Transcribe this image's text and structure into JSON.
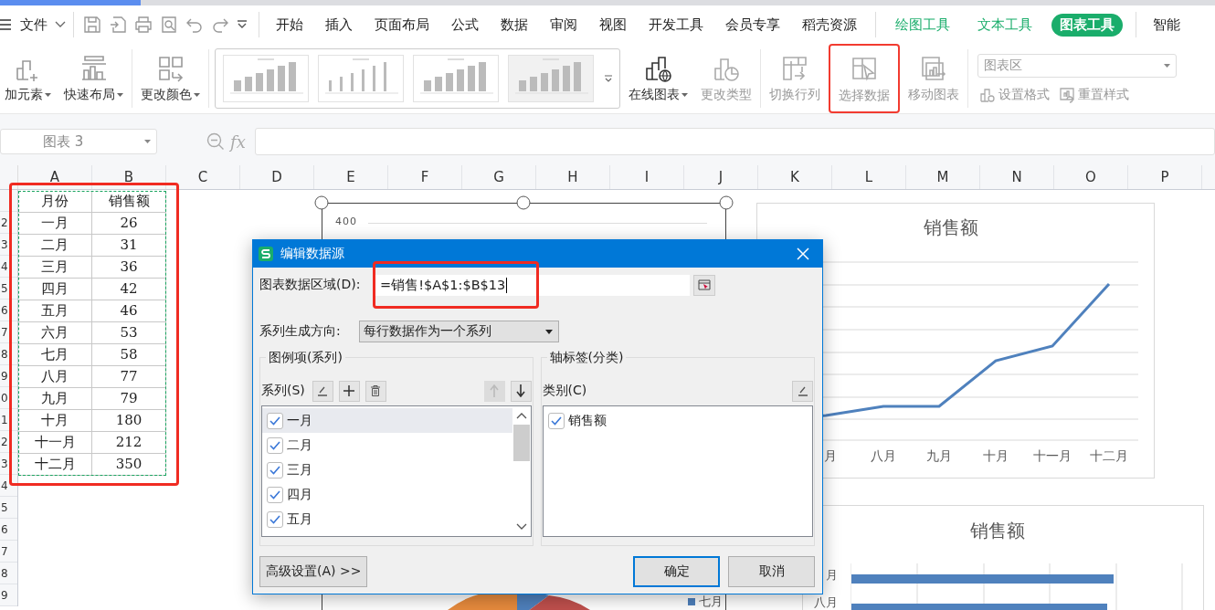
{
  "menu_bar": {
    "file_menu": "文件",
    "tabs": [
      {
        "label": "开始",
        "kind": "main",
        "selected": false
      },
      {
        "label": "插入",
        "kind": "main",
        "selected": false
      },
      {
        "label": "页面布局",
        "kind": "main",
        "selected": false
      },
      {
        "label": "公式",
        "kind": "main",
        "selected": false
      },
      {
        "label": "数据",
        "kind": "main",
        "selected": false
      },
      {
        "label": "审阅",
        "kind": "main",
        "selected": false
      },
      {
        "label": "视图",
        "kind": "main",
        "selected": false
      },
      {
        "label": "开发工具",
        "kind": "main",
        "selected": false
      },
      {
        "label": "会员专享",
        "kind": "main",
        "selected": false
      },
      {
        "label": "稻壳资源",
        "kind": "main",
        "selected": false
      },
      {
        "label": "绘图工具",
        "kind": "context",
        "selected": false
      },
      {
        "label": "文本工具",
        "kind": "context",
        "selected": false
      },
      {
        "label": "图表工具",
        "kind": "context",
        "selected": true
      },
      {
        "label": "智能",
        "kind": "main",
        "selected": false
      }
    ]
  },
  "ribbon": {
    "left_groups": [
      [
        {
          "label": "加元素",
          "kind": "add",
          "dropdown": true,
          "disabled": false,
          "highlighted": false
        },
        {
          "label": "快速布局",
          "kind": "layout",
          "dropdown": true,
          "disabled": false,
          "highlighted": false
        }
      ],
      [
        {
          "label": "更改颜色",
          "kind": "color",
          "dropdown": true,
          "disabled": false,
          "highlighted": false
        }
      ]
    ],
    "right_groups": [
      [
        {
          "label": "在线图表",
          "kind": "online",
          "dropdown": true,
          "disabled": false,
          "highlighted": false
        },
        {
          "label": "更改类型",
          "kind": "type",
          "dropdown": false,
          "disabled": true,
          "highlighted": false
        }
      ],
      [
        {
          "label": "切换行列",
          "kind": "switch",
          "dropdown": false,
          "disabled": true,
          "highlighted": false
        },
        {
          "label": "选择数据",
          "kind": "select",
          "dropdown": false,
          "disabled": true,
          "highlighted": true
        },
        {
          "label": "移动图表",
          "kind": "move",
          "dropdown": false,
          "disabled": true,
          "highlighted": false
        }
      ]
    ],
    "element_picker": {
      "value": "图表区"
    },
    "format_tools": [
      {
        "label": "设置格式",
        "kind": "format",
        "disabled": true
      },
      {
        "label": "重置样式",
        "kind": "reset",
        "disabled": true
      }
    ]
  },
  "formula_bar": {
    "name_box": "图表 3",
    "function_label": "fx"
  },
  "sheet": {
    "columns": [
      "A",
      "B",
      "C",
      "D",
      "E",
      "F",
      "G",
      "H",
      "I",
      "J",
      "K",
      "L",
      "M",
      "N",
      "O",
      "P"
    ],
    "row_labels": [
      "2",
      "3",
      "4",
      "5",
      "6",
      "7",
      "8",
      "9",
      "0",
      "1",
      "2",
      "3",
      "4",
      "5",
      "6",
      "7",
      "8",
      "9"
    ],
    "table_highlighted": true,
    "table": [
      [
        "月份",
        "销售额"
      ],
      [
        "一月",
        "26"
      ],
      [
        "二月",
        "31"
      ],
      [
        "三月",
        "36"
      ],
      [
        "四月",
        "42"
      ],
      [
        "五月",
        "46"
      ],
      [
        "六月",
        "53"
      ],
      [
        "七月",
        "58"
      ],
      [
        "八月",
        "77"
      ],
      [
        "九月",
        "79"
      ],
      [
        "十月",
        "180"
      ],
      [
        "十一月",
        "212"
      ],
      [
        "十二月",
        "350"
      ]
    ]
  },
  "charts": {
    "column_chart": {
      "axis_label": "400",
      "legend_label": "七月"
    },
    "line_chart": {
      "title": "销售额",
      "categories": [
        "月",
        "八月",
        "九月",
        "十月",
        "十一月",
        "十二月"
      ]
    },
    "bar_chart": {
      "title": "销售额",
      "categories": [
        "月",
        "八月"
      ]
    }
  },
  "dialog": {
    "title": "编辑数据源",
    "range_label": "图表数据区域(D):",
    "range_value": "=销售!$A$1:$B$13",
    "range_highlighted": true,
    "direction_label": "系列生成方向:",
    "direction_value": "每行数据作为一个系列",
    "series_group": {
      "title": "图例项(系列)",
      "label": "系列(S)",
      "move_up_disabled": true,
      "move_down_disabled": false,
      "items": [
        {
          "label": "一月",
          "checked": true,
          "selected": true
        },
        {
          "label": "二月",
          "checked": true,
          "selected": false
        },
        {
          "label": "三月",
          "checked": true,
          "selected": false
        },
        {
          "label": "四月",
          "checked": true,
          "selected": false
        },
        {
          "label": "五月",
          "checked": true,
          "selected": false
        }
      ]
    },
    "category_group": {
      "title": "轴标签(分类)",
      "label": "类别(C)",
      "items": [
        {
          "label": "销售额",
          "checked": true,
          "selected": false
        }
      ]
    },
    "buttons": [
      {
        "label": "高级设置(A) >>",
        "kind": "advanced",
        "default": false
      },
      {
        "label": "确定",
        "kind": "ok",
        "default": true
      },
      {
        "label": "取消",
        "kind": "cancel",
        "default": false
      }
    ]
  }
}
